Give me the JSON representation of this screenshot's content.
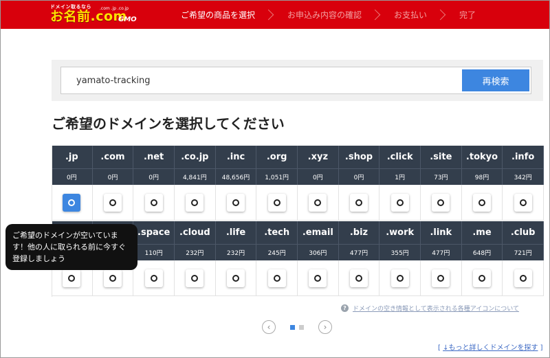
{
  "header": {
    "logo_tag": "ドメイン取るなら",
    "logo_main": "お名前.com",
    "logo_sub": ".com .jp .co.jp",
    "logo_gmo": "GMO",
    "steps": [
      {
        "label": "ご希望の商品を選択"
      },
      {
        "label": "お申込み内容の確認"
      },
      {
        "label": "お支払い"
      },
      {
        "label": "完了"
      }
    ]
  },
  "search": {
    "value": "yamato-tracking",
    "button_label": "再検索"
  },
  "page_title": "ご希望のドメインを選択してください",
  "domains_row1": [
    {
      "tld": ".jp",
      "price": "0円",
      "selected": true
    },
    {
      "tld": ".com",
      "price": "0円",
      "selected": false
    },
    {
      "tld": ".net",
      "price": "0円",
      "selected": false
    },
    {
      "tld": ".co.jp",
      "price": "4,841円",
      "selected": false
    },
    {
      "tld": ".inc",
      "price": "48,656円",
      "selected": false
    },
    {
      "tld": ".org",
      "price": "1,051円",
      "selected": false
    },
    {
      "tld": ".xyz",
      "price": "0円",
      "selected": false
    },
    {
      "tld": ".shop",
      "price": "0円",
      "selected": false
    },
    {
      "tld": ".click",
      "price": "1円",
      "selected": false
    },
    {
      "tld": ".site",
      "price": "73円",
      "selected": false
    },
    {
      "tld": ".tokyo",
      "price": "98円",
      "selected": false
    },
    {
      "tld": ".info",
      "price": "342円",
      "selected": false
    }
  ],
  "domains_row2": [
    {
      "tld": "",
      "price": "",
      "selected": false
    },
    {
      "tld": "",
      "price": "",
      "selected": false
    },
    {
      "tld": ".space",
      "price": "110円",
      "selected": false
    },
    {
      "tld": ".cloud",
      "price": "232円",
      "selected": false
    },
    {
      "tld": ".life",
      "price": "232円",
      "selected": false
    },
    {
      "tld": ".tech",
      "price": "245円",
      "selected": false
    },
    {
      "tld": ".email",
      "price": "306円",
      "selected": false
    },
    {
      "tld": ".biz",
      "price": "477円",
      "selected": false
    },
    {
      "tld": ".work",
      "price": "355円",
      "selected": false
    },
    {
      "tld": ".link",
      "price": "477円",
      "selected": false
    },
    {
      "tld": ".me",
      "price": "648円",
      "selected": false
    },
    {
      "tld": ".club",
      "price": "721円",
      "selected": false
    }
  ],
  "tooltip": {
    "text": "ご希望のドメインが空いています！他の人に取られる前に今すぐ登録しましょう"
  },
  "info_link": "ドメインの空き情報として表示される各種アイコンについて",
  "pager": {
    "prev": "‹",
    "next": "›"
  },
  "more_link": {
    "open": "[",
    "text": "↓もっと詳しくドメインを探す",
    "close": "]"
  },
  "colors": {
    "header_bg": "#d8000c",
    "accent": "#3d86e0",
    "table_header": "#333e4c"
  }
}
